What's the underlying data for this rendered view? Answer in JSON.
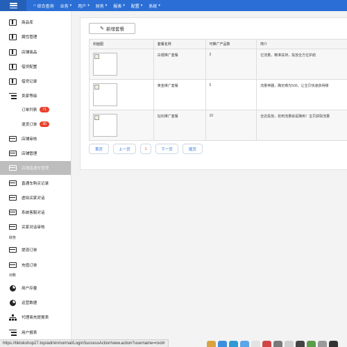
{
  "topnav": {
    "home_label": "综合查询",
    "menus": [
      "业务",
      "用户",
      "财务",
      "报表",
      "配置",
      "系统"
    ]
  },
  "sidebar": {
    "items": [
      {
        "label": "商品库",
        "icon": "book-icon"
      },
      {
        "label": "属性管理",
        "icon": "book-icon"
      },
      {
        "label": "店铺商品",
        "icon": "book-icon"
      },
      {
        "label": "借贷配置",
        "icon": "book-icon"
      },
      {
        "label": "借贷记录",
        "icon": "book-icon"
      },
      {
        "label": "卖家等级",
        "icon": "list-icon"
      },
      {
        "label": "订单列表",
        "badge": "71"
      },
      {
        "label": "退货订单",
        "badge": "30"
      },
      {
        "label": "店铺审核",
        "icon": "card-icon"
      },
      {
        "label": "店铺管理",
        "icon": "card-icon"
      },
      {
        "label": "店铺直通车管理",
        "icon": "card-icon"
      },
      {
        "label": "直通车购买记录",
        "icon": "card-icon"
      },
      {
        "label": "虚拟买家对话",
        "icon": "card-icon"
      },
      {
        "label": "系统客服对话",
        "icon": "card-icon"
      },
      {
        "label": "买家对话审核",
        "icon": "card-icon"
      },
      {
        "label": "提现订单",
        "icon": "card-icon"
      },
      {
        "label": "充值订单",
        "icon": "card-icon"
      },
      {
        "label": "用户存量",
        "icon": "pie-icon"
      },
      {
        "label": "运营数据",
        "icon": "pie-icon"
      },
      {
        "label": "代理商充提报表",
        "icon": "tree-icon"
      },
      {
        "label": "用户报表",
        "icon": "list-icon"
      }
    ],
    "groups": {
      "finance": "财务",
      "reports": "对账"
    }
  },
  "main": {
    "add_button": "新增套餐",
    "table": {
      "headers": [
        "封面图",
        "套餐名称",
        "可推广产品数",
        "简介"
      ],
      "rows": [
        {
          "name": "白银推广套餐",
          "count": "2",
          "desc": "亿流量，精准扶持，投放全方位护航"
        },
        {
          "name": "黄金推广套餐",
          "count": "5",
          "desc": "流量神器，确定曝光500，让宝贝快速获得曝"
        },
        {
          "name": "钻石推广套餐",
          "count": "10",
          "desc": "全店投放，抢到流量就是赚到！宝贝获取流量"
        }
      ]
    },
    "pager": {
      "first": "首页",
      "prev": "上一页",
      "current": "1",
      "next": "下一页",
      "last": "尾页"
    }
  },
  "statusbar": {
    "url": "https://tiktokshop27.top/admin/normal/LoginSuccessAction!view.action?username=root#"
  },
  "colors": {
    "nav_blue": "#2b6fd6",
    "badge_red": "#e8412d",
    "active_grey": "#bdbdbd"
  }
}
